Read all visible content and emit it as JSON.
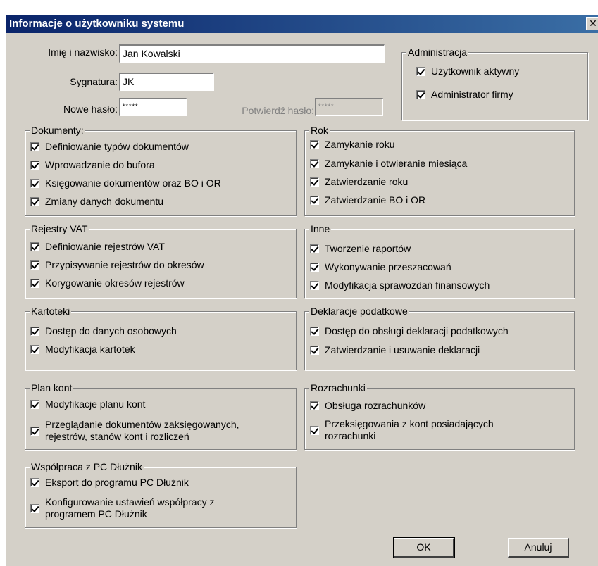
{
  "window": {
    "title": "Informacje o użytkowniku systemu",
    "close_label": "✕"
  },
  "fields": {
    "name_label": "Imię i nazwisko:",
    "name_value": "Jan Kowalski",
    "signature_label": "Sygnatura:",
    "signature_value": "JK",
    "new_password_label": "Nowe hasło:",
    "new_password_value": "*****",
    "confirm_password_label": "Potwierdź hasło:",
    "confirm_password_value": "*****"
  },
  "groups": {
    "administracja": {
      "title": "Administracja",
      "items": [
        "Użytkownik aktywny",
        "Administrator firmy"
      ]
    },
    "dokumenty": {
      "title": "Dokumenty:",
      "items": [
        "Definiowanie typów dokumentów",
        "Wprowadzanie do bufora",
        "Księgowanie dokumentów oraz BO i OR",
        "Zmiany danych dokumentu"
      ]
    },
    "rok": {
      "title": "Rok",
      "items": [
        "Zamykanie roku",
        "Zamykanie i otwieranie miesiąca",
        "Zatwierdzanie roku",
        "Zatwierdzanie BO i OR"
      ]
    },
    "rejestry": {
      "title": "Rejestry VAT",
      "items": [
        "Definiowanie rejestrów VAT",
        "Przypisywanie rejestrów do okresów",
        "Korygowanie okresów rejestrów"
      ]
    },
    "inne": {
      "title": "Inne",
      "items": [
        "Tworzenie raportów",
        "Wykonywanie przeszacowań",
        "Modyfikacja sprawozdań finansowych"
      ]
    },
    "kartoteki": {
      "title": "Kartoteki",
      "items": [
        "Dostęp do danych osobowych",
        "Modyfikacja kartotek"
      ]
    },
    "deklaracje": {
      "title": "Deklaracje podatkowe",
      "items": [
        "Dostęp do obsługi deklaracji podatkowych",
        "Zatwierdzanie i usuwanie deklaracji"
      ]
    },
    "plan": {
      "title": "Plan kont",
      "items": [
        "Modyfikacje planu kont",
        "Przeglądanie dokumentów zaksięgowanych, rejestrów, stanów kont i rozliczeń"
      ]
    },
    "rozrachunki": {
      "title": "Rozrachunki",
      "items": [
        "Obsługa rozrachunków",
        "Przeksięgowania z kont posiadających rozrachunki"
      ]
    },
    "pcdluznik": {
      "title": "Współpraca z PC Dłużnik",
      "items": [
        "Eksport do programu PC Dłużnik",
        "Konfigurowanie ustawień współpracy z programem PC Dłużnik"
      ]
    }
  },
  "buttons": {
    "ok": "OK",
    "cancel": "Anuluj"
  }
}
